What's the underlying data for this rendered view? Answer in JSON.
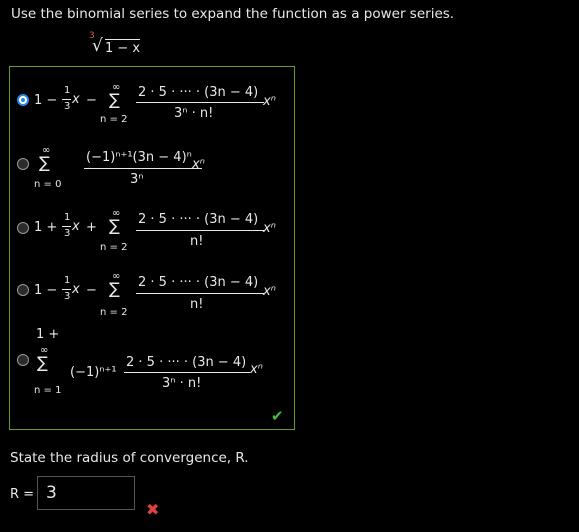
{
  "question": {
    "prompt": "Use the binomial series to expand the function as a power series.",
    "function": {
      "index": "3",
      "radicand": "1 − x"
    }
  },
  "options": [
    {
      "selected": true,
      "parts": {
        "lead": "1 −",
        "frac_num": "1",
        "frac_den": "3",
        "x": "x",
        "minus": "−",
        "sum_top": "∞",
        "sum_sym": "∑",
        "sum_bottom": "n = 2",
        "num": "2 · 5 · ··· · (3n − 4)",
        "den": "3ⁿ · n!",
        "xn": "xⁿ"
      }
    },
    {
      "selected": false,
      "parts": {
        "sum_top": "∞",
        "sum_sym": "∑",
        "sum_bottom": "n = 0",
        "num": "(−1)ⁿ⁺¹(3n − 4)ⁿ",
        "den": "3ⁿ",
        "xn": "xⁿ"
      }
    },
    {
      "selected": false,
      "parts": {
        "lead": "1 +",
        "frac_num": "1",
        "frac_den": "3",
        "x": "x",
        "minus": "+",
        "sum_top": "∞",
        "sum_sym": "∑",
        "sum_bottom": "n = 2",
        "num": "2 · 5 · ··· · (3n − 4)",
        "den": "n!",
        "xn": "xⁿ"
      }
    },
    {
      "selected": false,
      "parts": {
        "lead": "1 −",
        "frac_num": "1",
        "frac_den": "3",
        "x": "x",
        "minus": "−",
        "sum_top": "∞",
        "sum_sym": "∑",
        "sum_bottom": "n = 2",
        "num": "2 · 5 · ··· · (3n − 4)",
        "den": "n!",
        "xn": "xⁿ"
      }
    },
    {
      "selected": false,
      "parts": {
        "lead": "1 +",
        "sum_top": "∞",
        "sum_sym": "∑",
        "sum_bottom": "n = 1",
        "coef": "(−1)ⁿ⁺¹",
        "num": "2 · 5 · ··· · (3n − 4)",
        "den": "3ⁿ · n!",
        "xn": "xⁿ"
      }
    }
  ],
  "status_icons": {
    "options_result": "check-icon",
    "radius_result": "cross-icon"
  },
  "radius": {
    "question": "State the radius of convergence, R.",
    "label": "R =",
    "value": "3"
  },
  "colors": {
    "correct": "#3fbf3f",
    "incorrect": "#e04040",
    "selected": "#2a86e0",
    "box_border": "#6a9a2a"
  }
}
